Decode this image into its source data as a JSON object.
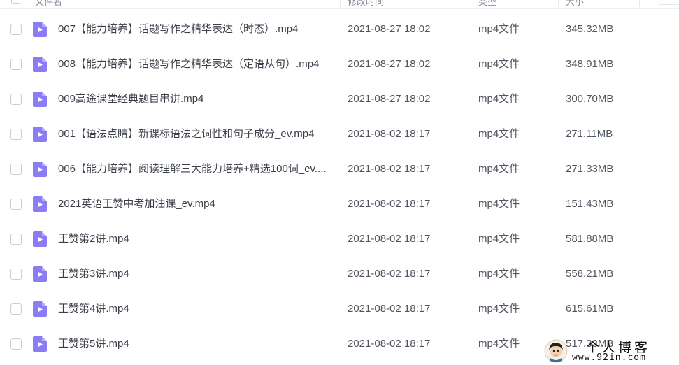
{
  "header": {
    "name_label": "文件名",
    "modified_label": "修改时间",
    "type_label": "类型",
    "size_label": "大小"
  },
  "files": [
    {
      "name": "007【能力培养】话题写作之精华表达（时态）.mp4",
      "modified": "2021-08-27 18:02",
      "type": "mp4文件",
      "size": "345.32MB"
    },
    {
      "name": "008【能力培养】话题写作之精华表达（定语从句）.mp4",
      "modified": "2021-08-27 18:02",
      "type": "mp4文件",
      "size": "348.91MB"
    },
    {
      "name": "009高途课堂经典题目串讲.mp4",
      "modified": "2021-08-27 18:02",
      "type": "mp4文件",
      "size": "300.70MB"
    },
    {
      "name": "001【语法点睛】新课标语法之词性和句子成分_ev.mp4",
      "modified": "2021-08-02 18:17",
      "type": "mp4文件",
      "size": "271.11MB"
    },
    {
      "name": "006【能力培养】阅读理解三大能力培养+精选100词_ev....",
      "modified": "2021-08-02 18:17",
      "type": "mp4文件",
      "size": "271.33MB"
    },
    {
      "name": "2021英语王赞中考加油课_ev.mp4",
      "modified": "2021-08-02 18:17",
      "type": "mp4文件",
      "size": "151.43MB"
    },
    {
      "name": "王赞第2讲.mp4",
      "modified": "2021-08-02 18:17",
      "type": "mp4文件",
      "size": "581.88MB"
    },
    {
      "name": "王赞第3讲.mp4",
      "modified": "2021-08-02 18:17",
      "type": "mp4文件",
      "size": "558.21MB"
    },
    {
      "name": "王赞第4讲.mp4",
      "modified": "2021-08-02 18:17",
      "type": "mp4文件",
      "size": "615.61MB"
    },
    {
      "name": "王赞第5讲.mp4",
      "modified": "2021-08-02 18:17",
      "type": "mp4文件",
      "size": "517.33MB"
    }
  ],
  "watermark": {
    "title": "个人博客",
    "url": "www.92in.com"
  },
  "colors": {
    "file_icon": "#8b7cf6",
    "file_icon_fold": "#b7adfb",
    "sort_accent": "#4c7cf3"
  },
  "icons": {
    "file": "video-file-icon",
    "sort": "sort-down-icon",
    "checkbox": "checkbox-icon"
  }
}
